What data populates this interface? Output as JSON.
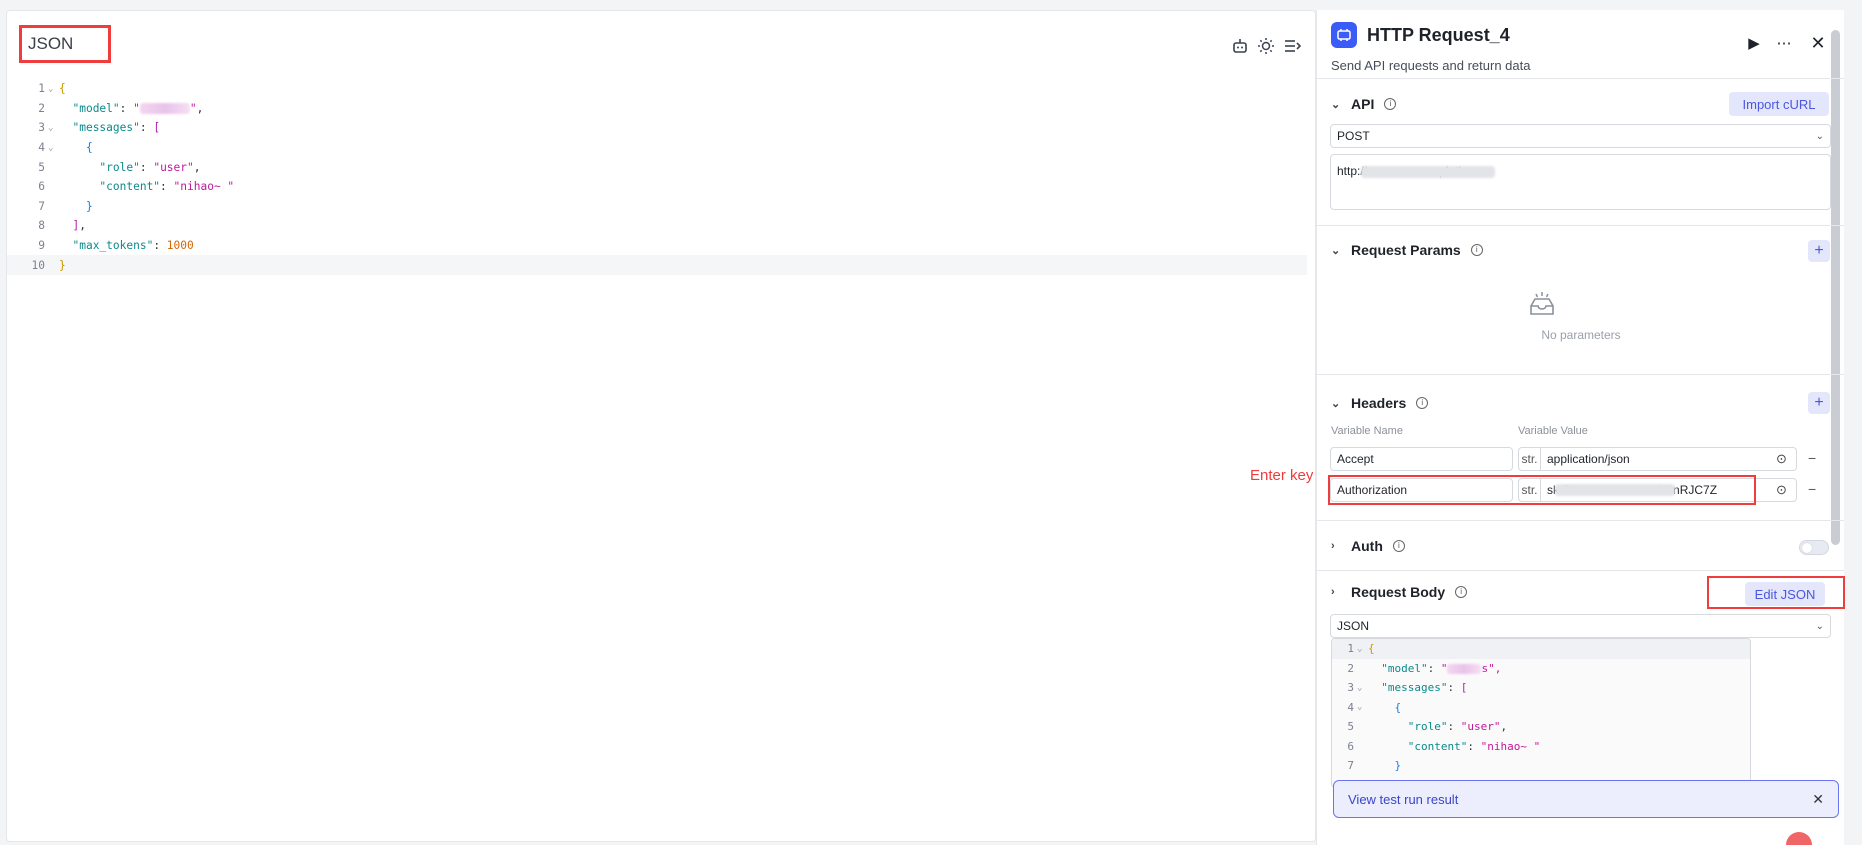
{
  "editor": {
    "title": "JSON",
    "lines": [
      {
        "n": "1",
        "fold": true
      },
      {
        "n": "2"
      },
      {
        "n": "3",
        "fold": true
      },
      {
        "n": "4",
        "fold": true
      },
      {
        "n": "5"
      },
      {
        "n": "6"
      },
      {
        "n": "7"
      },
      {
        "n": "8"
      },
      {
        "n": "9"
      },
      {
        "n": "10"
      }
    ],
    "tokens": {
      "model_key": "\"model\"",
      "messages_key": "\"messages\"",
      "role_key": "\"role\"",
      "role_val": "\"user\"",
      "content_key": "\"content\"",
      "content_val": "\"nihao~ \"",
      "max_tokens_key": "\"max_tokens\"",
      "max_tokens_val": "1000"
    }
  },
  "panel": {
    "title": "HTTP Request_4",
    "description": "Send API requests and return data",
    "api": {
      "label": "API",
      "import_label": "Import cURL",
      "method": "POST",
      "url": "http://      pletions"
    },
    "params": {
      "label": "Request Params",
      "empty": "No parameters"
    },
    "headers": {
      "label": "Headers",
      "col_name": "Variable Name",
      "col_value": "Variable Value",
      "rows": [
        {
          "name": "Accept",
          "type": "str.",
          "value": "application/json"
        },
        {
          "name": "Authorization",
          "type": "str.",
          "value": "sk-5i       0f0nRJC7Z"
        }
      ]
    },
    "auth": {
      "label": "Auth"
    },
    "body": {
      "label": "Request Body",
      "edit_label": "Edit JSON",
      "type": "JSON",
      "tail": "s\","
    },
    "toast": {
      "label": "View test run result"
    }
  },
  "annotation": {
    "enter_key": "Enter key"
  }
}
